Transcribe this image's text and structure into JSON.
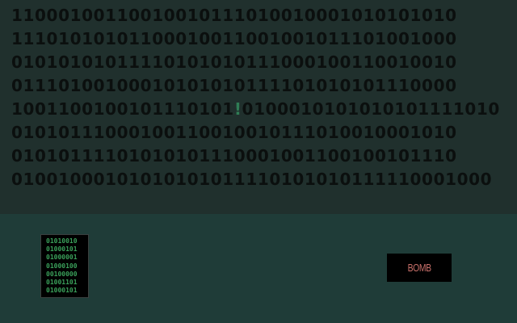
{
  "binary_grid": {
    "rows": [
      {
        "before": "11000100110010010111010010001010101010",
        "mark": "",
        "after": ""
      },
      {
        "before": "11101010101100010011001001011101001000",
        "mark": "",
        "after": ""
      },
      {
        "before": "01010101011110101010111000100110010010",
        "mark": "",
        "after": ""
      },
      {
        "before": "01110100100010101010111101010101110000",
        "mark": "",
        "after": ""
      },
      {
        "before": "1001100100101110101",
        "mark": "!",
        "after": "0100010101010101111010"
      },
      {
        "before": "01010111000100110010010111010010001010",
        "mark": "",
        "after": ""
      },
      {
        "before": "01010111101010101110001001100100101110",
        "mark": "",
        "after": ""
      },
      {
        "before": "01001000101010101011110101010111110001000",
        "mark": "",
        "after": ""
      }
    ]
  },
  "code_panel": {
    "lines": [
      "01010010",
      "01000101",
      "01000001",
      "01000100",
      "00100000",
      "01001101",
      "01000101"
    ]
  },
  "bomb_button": {
    "label": "BOMB"
  }
}
